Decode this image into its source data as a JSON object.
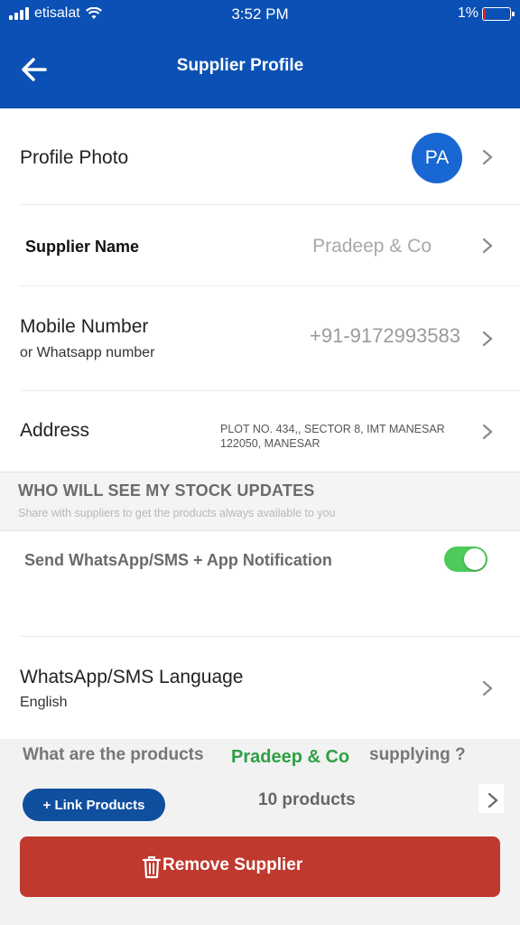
{
  "status_bar": {
    "carrier": "etisalat",
    "time": "3:52 PM",
    "battery": "1%"
  },
  "header": {
    "title": "Supplier Profile",
    "back_icon": "arrow-left-icon"
  },
  "profile_photo": {
    "label": "Profile Photo",
    "initials": "PA"
  },
  "supplier_name": {
    "label": "Supplier Name",
    "value": "Pradeep & Co"
  },
  "mobile": {
    "label": "Mobile Number",
    "sublabel": "or Whatsapp number",
    "value": "+91-9172993583"
  },
  "address": {
    "label": "Address",
    "line1": "PLOT NO. 434,, SECTOR 8, IMT MANESAR",
    "line2": "122050, MANESAR"
  },
  "stock_section": {
    "title": "WHO WILL SEE MY STOCK UPDATES",
    "subtitle": "Share with suppliers to get the products always available to you"
  },
  "notification": {
    "label": "Send WhatsApp/SMS + App Notification",
    "enabled": true
  },
  "language": {
    "label": "WhatsApp/SMS Language",
    "value": "English"
  },
  "products": {
    "question_prefix": "What are the products",
    "supplier": "Pradeep & Co",
    "question_suffix": "supplying ?",
    "link_button": "+ Link Products",
    "count": "10 products"
  },
  "remove_button": {
    "label": "Remove Supplier"
  },
  "colors": {
    "header": "#0b50b4",
    "avatar": "#1867d2",
    "toggle_on": "#4cca5a",
    "link_button": "#0f4f9e",
    "remove_button": "#c0392f",
    "highlight": "#2ea043"
  }
}
